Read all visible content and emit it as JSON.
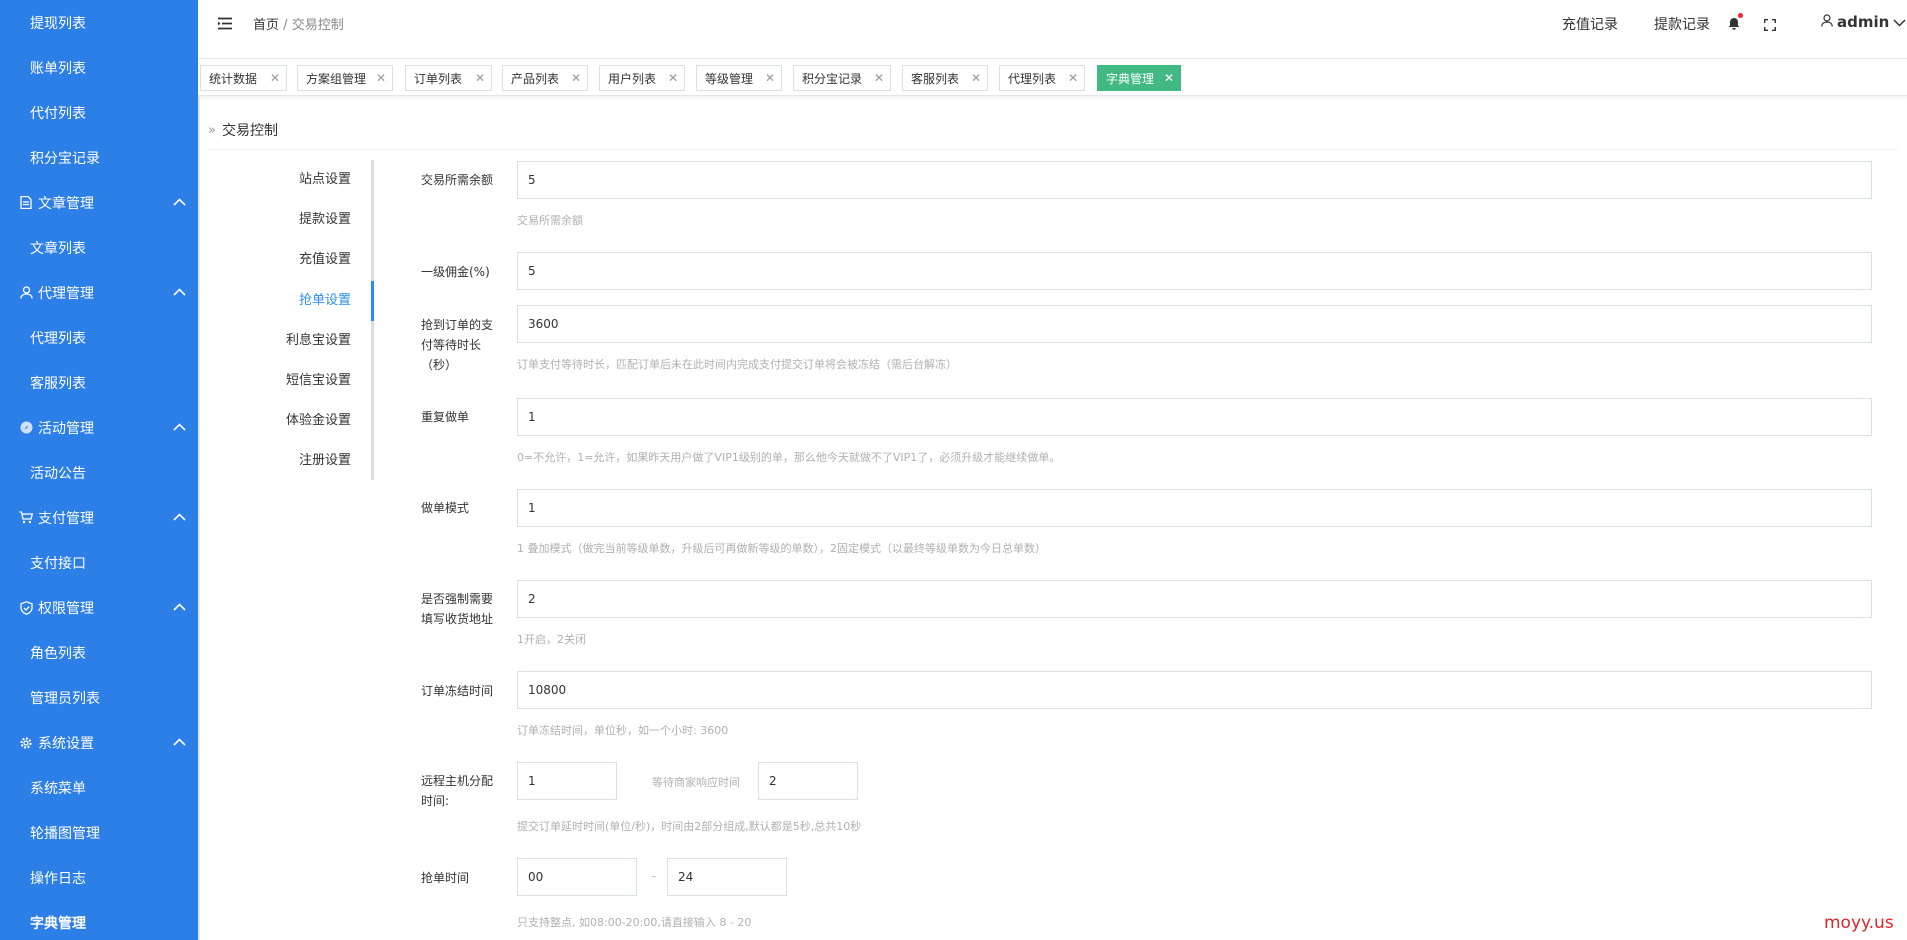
{
  "sidebar": {
    "items": [
      {
        "label": "提现列表"
      },
      {
        "label": "账单列表"
      },
      {
        "label": "代付列表"
      },
      {
        "label": "积分宝记录"
      },
      {
        "label": "文章管理",
        "icon": "document-icon"
      },
      {
        "label": "文章列表"
      },
      {
        "label": "代理管理",
        "icon": "user-icon"
      },
      {
        "label": "代理列表"
      },
      {
        "label": "客服列表"
      },
      {
        "label": "活动管理",
        "icon": "compass-icon"
      },
      {
        "label": "活动公告"
      },
      {
        "label": "支付管理",
        "icon": "cart-icon"
      },
      {
        "label": "支付接口"
      },
      {
        "label": "权限管理",
        "icon": "shield-icon"
      },
      {
        "label": "角色列表"
      },
      {
        "label": "管理员列表"
      },
      {
        "label": "系统设置",
        "icon": "gear-icon"
      },
      {
        "label": "系统菜单"
      },
      {
        "label": "轮播图管理"
      },
      {
        "label": "操作日志"
      },
      {
        "label": "字典管理"
      }
    ]
  },
  "header": {
    "breadcrumb_home": "首页",
    "breadcrumb_sep": "/",
    "breadcrumb_current": "交易控制",
    "recharge_link": "充值记录",
    "withdraw_link": "提款记录",
    "user": "admin"
  },
  "tabs": [
    {
      "label": "统计数据"
    },
    {
      "label": "方案组管理"
    },
    {
      "label": "订单列表"
    },
    {
      "label": "产品列表"
    },
    {
      "label": "用户列表"
    },
    {
      "label": "等级管理"
    },
    {
      "label": "积分宝记录"
    },
    {
      "label": "客服列表"
    },
    {
      "label": "代理列表"
    },
    {
      "label": "字典管理",
      "active": true
    }
  ],
  "section_title": "交易控制",
  "subnav": [
    {
      "label": "站点设置"
    },
    {
      "label": "提款设置"
    },
    {
      "label": "充值设置"
    },
    {
      "label": "抢单设置",
      "active": true
    },
    {
      "label": "利息宝设置"
    },
    {
      "label": "短信宝设置"
    },
    {
      "label": "体验金设置"
    },
    {
      "label": "注册设置"
    }
  ],
  "form": {
    "balance": {
      "label": "交易所需余额",
      "value": "5",
      "hint": "交易所需余额"
    },
    "commission": {
      "label": "一级佣金(%)",
      "value": "5"
    },
    "pay_wait": {
      "label": "抢到订单的支付等待时长（秒）",
      "value": "3600",
      "hint": "订单支付等待时长，匹配订单后未在此时间内完成支付提交订单将会被冻结（需后台解冻）"
    },
    "repeat": {
      "label": "重复做单",
      "value": "1",
      "hint": "0=不允许，1=允许，如果昨天用户做了VIP1级别的单，那么他今天就做不了VIP1了，必须升级才能继续做单。"
    },
    "mode": {
      "label": "做单模式",
      "value": "1",
      "hint": "1 叠加模式（做完当前等级单数，升级后可再做新等级的单数），2固定模式（以最终等级单数为今日总单数）"
    },
    "address": {
      "label": "是否强制需要填写收货地址",
      "value": "2",
      "hint": "1开启，2关闭"
    },
    "freeze": {
      "label": "订单冻结时间",
      "value": "10800",
      "hint": "订单冻结时间，单位秒，如一个小时: 3600"
    },
    "remote": {
      "label": "远程主机分配时间:",
      "value1": "1",
      "inline_label": "等待商家响应时间",
      "value2": "2",
      "hint": "提交订单延时时间(单位/秒)，时间由2部分组成,默认都是5秒,总共10秒"
    },
    "grab_time": {
      "label": "抢单时间",
      "start": "00",
      "dash": "-",
      "end": "24",
      "hint": "只支持整点, 如08:00-20:00,请直接输入 8 - 20"
    }
  },
  "watermark": "moyy.us"
}
